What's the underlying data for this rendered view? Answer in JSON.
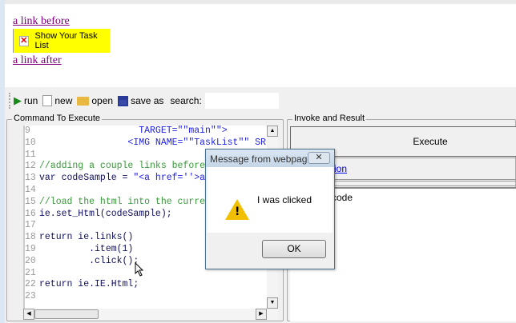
{
  "webpage": {
    "link_before": "a link before",
    "task_button": "Show Your Task List",
    "link_after": "a link after"
  },
  "toolbar": {
    "run": "run",
    "new": "new",
    "open": "open",
    "save_as": "save as",
    "search_label": "search:",
    "search_value": ""
  },
  "command_panel": {
    "title": "Command To Execute",
    "lines": [
      {
        "n": "9",
        "segs": [
          {
            "t": "                  TARGET=\"\"main\"\">",
            "k": "blue"
          }
        ]
      },
      {
        "n": "10",
        "segs": [
          {
            "t": "                <IMG NAME=\"\"TaskList\"\" SR",
            "k": "blue"
          }
        ]
      },
      {
        "n": "11",
        "segs": []
      },
      {
        "n": "12",
        "segs": [
          {
            "t": "//adding a couple links before a",
            "k": "green"
          }
        ]
      },
      {
        "n": "13",
        "segs": [
          {
            "t": "var codeSample = ",
            "k": "navy"
          },
          {
            "t": "\"<a href=''>a l",
            "k": "blue"
          }
        ]
      },
      {
        "n": "14",
        "segs": []
      },
      {
        "n": "15",
        "segs": [
          {
            "t": "//load the html into the current",
            "k": "green"
          }
        ]
      },
      {
        "n": "16",
        "segs": [
          {
            "t": "ie.set_Html(codeSample);",
            "k": "navy"
          }
        ]
      },
      {
        "n": "17",
        "segs": []
      },
      {
        "n": "18",
        "segs": [
          {
            "t": "return ie.links()",
            "k": "navy"
          }
        ]
      },
      {
        "n": "19",
        "segs": [
          {
            "t": "         .item(1)",
            "k": "navy"
          }
        ]
      },
      {
        "n": "20",
        "segs": [
          {
            "t": "         .click();",
            "k": "navy"
          }
        ]
      },
      {
        "n": "21",
        "segs": []
      },
      {
        "n": "22",
        "segs": [
          {
            "t": "return ie.IE.Html;",
            "k": "navy"
          }
        ]
      },
      {
        "n": "23",
        "segs": []
      }
    ]
  },
  "invoke_panel": {
    "title": "Invoke and Result",
    "execute": "Execute",
    "link_fragment": "ion",
    "result_fragment": "code"
  },
  "dialog": {
    "title": "Message from webpage",
    "message": "I was clicked",
    "ok": "OK",
    "close": "✕"
  }
}
